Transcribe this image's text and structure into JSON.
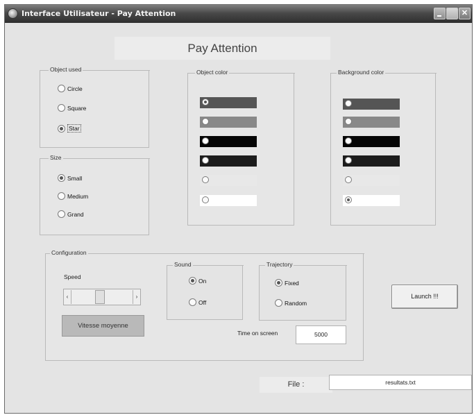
{
  "window": {
    "title": "Interface Utilisateur - Pay Attention",
    "controls": {
      "minimize": "",
      "maximize": "",
      "close": "✕"
    }
  },
  "header": {
    "title": "Pay Attention"
  },
  "object_used": {
    "title": "Object used",
    "options": [
      {
        "label": "Circle",
        "selected": false
      },
      {
        "label": "Square",
        "selected": false
      },
      {
        "label": "Star",
        "selected": true
      }
    ]
  },
  "size": {
    "title": "Size",
    "options": [
      {
        "label": "Small",
        "selected": true
      },
      {
        "label": "Medium",
        "selected": false
      },
      {
        "label": "Grand",
        "selected": false
      }
    ]
  },
  "object_color": {
    "title": "Object color",
    "swatches": [
      {
        "color": "#555555",
        "selected": true
      },
      {
        "color": "#888888",
        "selected": false
      },
      {
        "color": "#050505",
        "selected": false
      },
      {
        "color": "#1c1c1c",
        "selected": false
      },
      {
        "color": "#e8e8e8",
        "selected": false
      },
      {
        "color": "#ffffff",
        "selected": false
      }
    ]
  },
  "background_color": {
    "title": "Background color",
    "swatches": [
      {
        "color": "#555555",
        "selected": false
      },
      {
        "color": "#888888",
        "selected": false
      },
      {
        "color": "#050505",
        "selected": false
      },
      {
        "color": "#1c1c1c",
        "selected": false
      },
      {
        "color": "#e8e8e8",
        "selected": false
      },
      {
        "color": "#ffffff",
        "selected": true
      }
    ]
  },
  "configuration": {
    "title": "Configuration",
    "speed_label": "Speed",
    "speed_value_text": "Vitesse moyenne",
    "slider_left_arrow": "‹",
    "slider_right_arrow": "›",
    "sound": {
      "title": "Sound",
      "options": [
        {
          "label": "On",
          "selected": true
        },
        {
          "label": "Off",
          "selected": false
        }
      ]
    },
    "trajectory": {
      "title": "Trajectory",
      "options": [
        {
          "label": "Fixed",
          "selected": true
        },
        {
          "label": "Random",
          "selected": false
        }
      ]
    },
    "time_on_screen_label": "Time on screen",
    "time_on_screen_value": "5000"
  },
  "launch_button": {
    "label": "Launch !!!"
  },
  "file": {
    "label": "File :",
    "value": "resultats.txt"
  }
}
